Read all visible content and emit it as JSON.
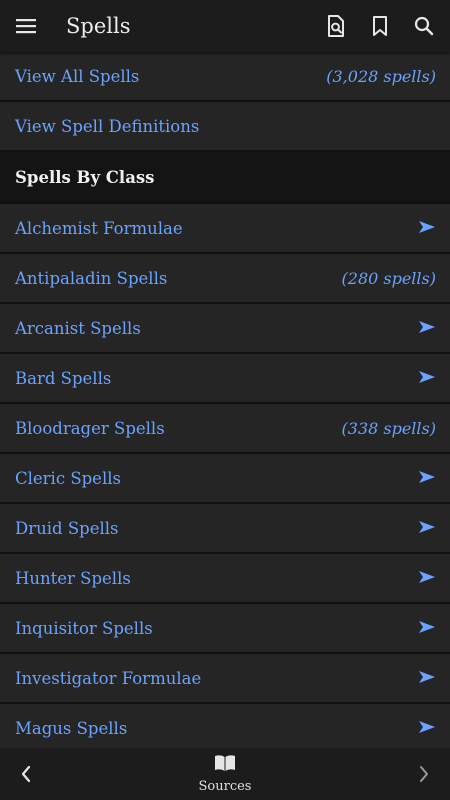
{
  "appbar": {
    "title": "Spells",
    "menu_icon": "hamburger-menu-icon",
    "actions": [
      "search-document-icon",
      "bookmark-icon",
      "search-icon"
    ]
  },
  "rows_top": [
    {
      "label": "View All Spells",
      "count": "(3,028 spells)"
    },
    {
      "label": "View Spell Definitions",
      "count": ""
    }
  ],
  "section": {
    "title": "Spells By Class"
  },
  "class_rows": [
    {
      "label": "Alchemist Formulae",
      "count": ""
    },
    {
      "label": "Antipaladin Spells",
      "count": "(280 spells)"
    },
    {
      "label": "Arcanist Spells",
      "count": ""
    },
    {
      "label": "Bard Spells",
      "count": ""
    },
    {
      "label": "Bloodrager Spells",
      "count": "(338 spells)"
    },
    {
      "label": "Cleric Spells",
      "count": ""
    },
    {
      "label": "Druid Spells",
      "count": ""
    },
    {
      "label": "Hunter Spells",
      "count": ""
    },
    {
      "label": "Inquisitor Spells",
      "count": ""
    },
    {
      "label": "Investigator Formulae",
      "count": ""
    },
    {
      "label": "Magus Spells",
      "count": ""
    }
  ],
  "bottombar": {
    "center_label": "Sources",
    "center_icon": "open-book-icon",
    "left_icon": "chevron-left-icon",
    "right_icon": "chevron-right-icon"
  },
  "colors": {
    "link": "#6aa3ff",
    "background": "#252525",
    "bar": "#1c1c1c",
    "section": "#141414"
  }
}
